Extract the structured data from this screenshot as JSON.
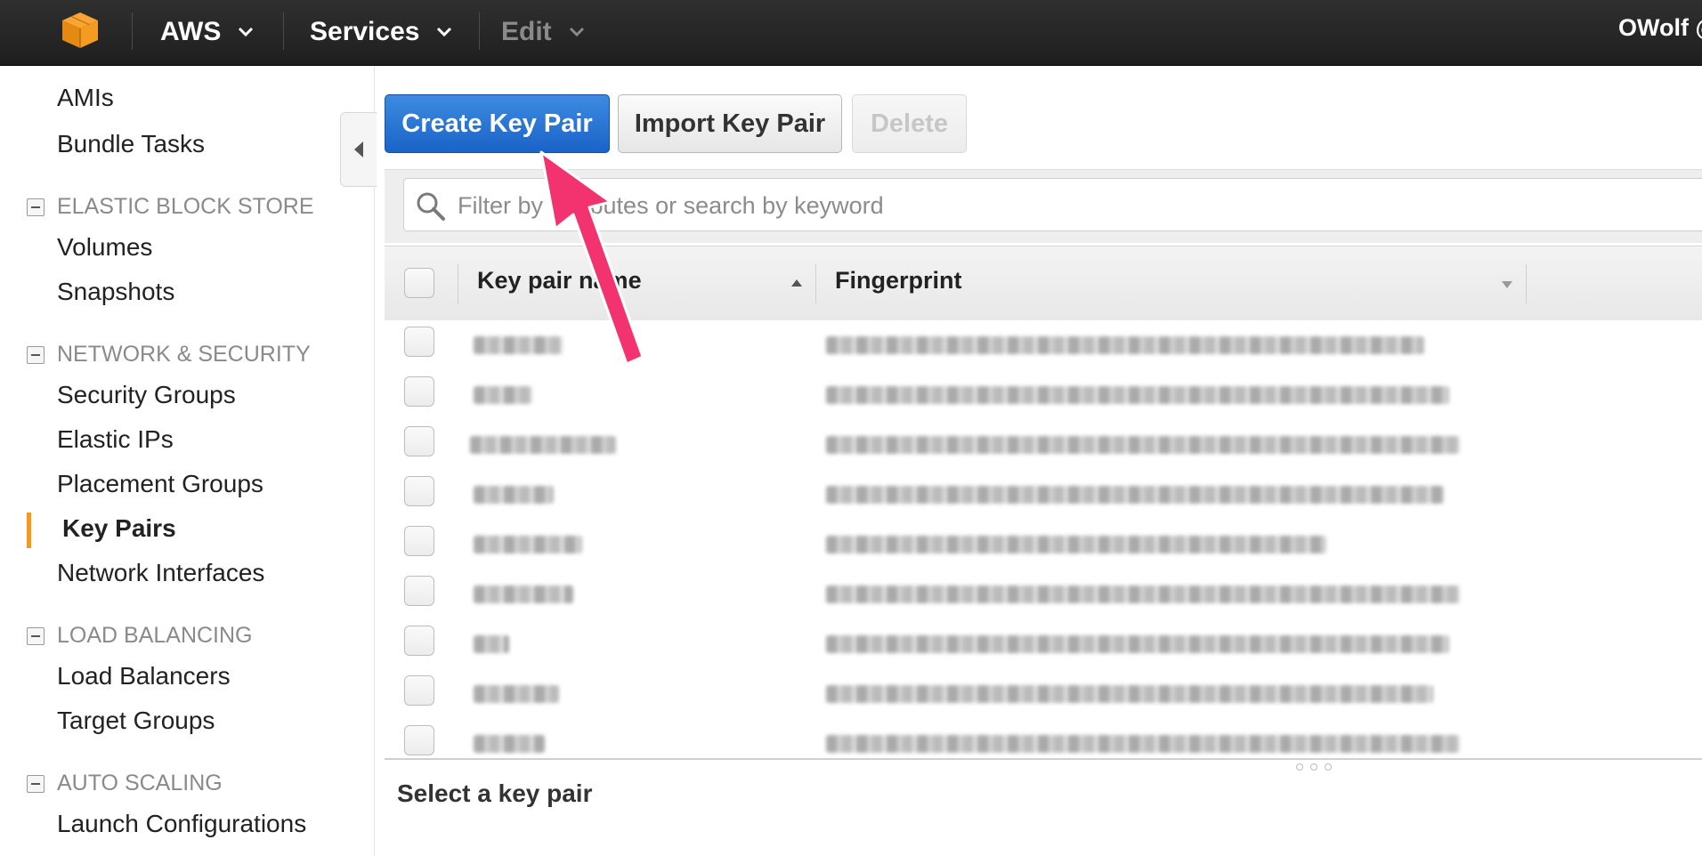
{
  "topbar": {
    "logo_icon": "aws-cube-icon",
    "aws_label": "AWS",
    "services_label": "Services",
    "edit_label": "Edit",
    "user_label": "OWolf @"
  },
  "sidebar": {
    "items_top": [
      {
        "label": "AMIs"
      },
      {
        "label": "Bundle Tasks"
      }
    ],
    "sections": [
      {
        "title": "ELASTIC BLOCK STORE",
        "items": [
          "Volumes",
          "Snapshots"
        ]
      },
      {
        "title": "NETWORK & SECURITY",
        "items": [
          "Security Groups",
          "Elastic IPs",
          "Placement Groups",
          "Key Pairs",
          "Network Interfaces"
        ]
      },
      {
        "title": "LOAD BALANCING",
        "items": [
          "Load Balancers",
          "Target Groups"
        ]
      },
      {
        "title": "AUTO SCALING",
        "items": [
          "Launch Configurations"
        ]
      }
    ],
    "active_item": "Key Pairs",
    "active_color": "#f7981d"
  },
  "toolbar": {
    "create_label": "Create Key Pair",
    "import_label": "Import Key Pair",
    "delete_label": "Delete",
    "primary_color": "#1a63c8"
  },
  "search": {
    "placeholder": "Filter by attributes or search by keyword",
    "value": ""
  },
  "table": {
    "columns": [
      {
        "label": "Key pair name",
        "sort": "ascending"
      },
      {
        "label": "Fingerprint",
        "sort": "dropdown"
      }
    ],
    "rows": [
      {
        "name": "",
        "fingerprint": ""
      },
      {
        "name": "",
        "fingerprint": ""
      },
      {
        "name": "",
        "fingerprint": ""
      },
      {
        "name": "",
        "fingerprint": ""
      },
      {
        "name": "",
        "fingerprint": ""
      },
      {
        "name": "",
        "fingerprint": ""
      },
      {
        "name": "",
        "fingerprint": ""
      },
      {
        "name": "",
        "fingerprint": ""
      },
      {
        "name": "",
        "fingerprint": ""
      }
    ]
  },
  "detail": {
    "label": "Select a key pair"
  },
  "annotation": {
    "arrow_color": "#f2336f"
  }
}
